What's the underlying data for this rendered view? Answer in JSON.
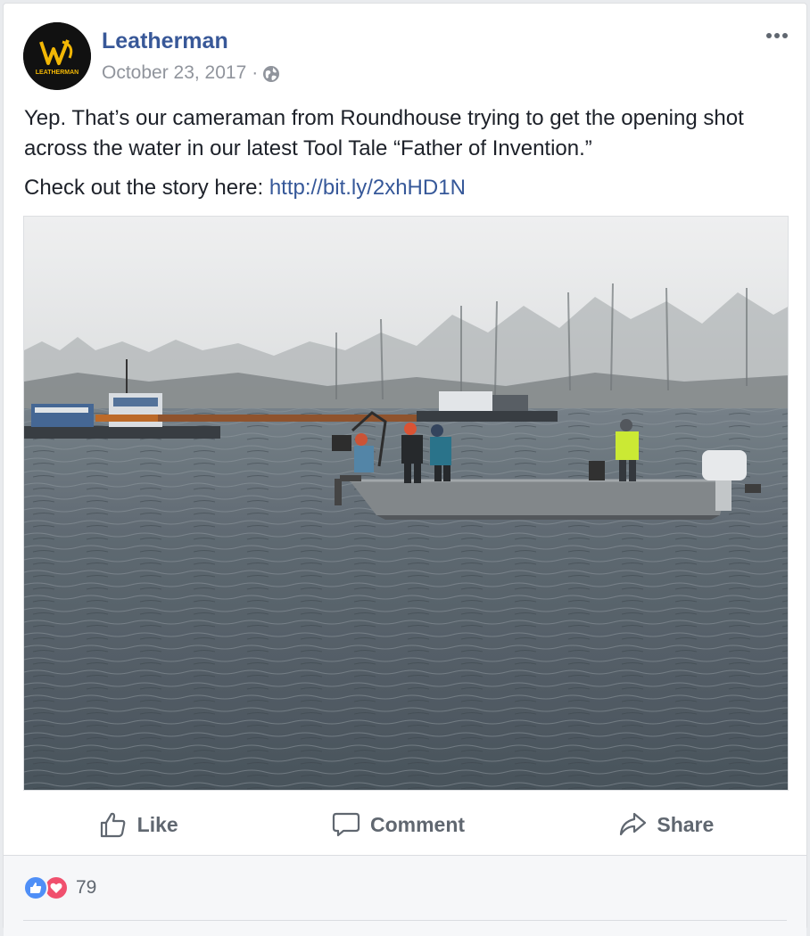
{
  "post": {
    "author": "Leatherman",
    "logo_text": "LEATHERMAN",
    "date": "October 23, 2017",
    "separator": "·",
    "privacy_icon": "globe-icon",
    "more_icon": "more-options-icon",
    "text_line_1": "Yep. That’s our cameraman from Roundhouse trying to get the opening shot across the water in our latest Tool Tale “Father of Invention.”",
    "text_prefix": "Check out the story here: ",
    "link": "http://bit.ly/2xhHD1N"
  },
  "actions": {
    "like_label": "Like",
    "comment_label": "Comment",
    "share_label": "Share"
  },
  "reactions": {
    "types": [
      "like-icon",
      "love-icon"
    ],
    "count": "79"
  },
  "colors": {
    "brand_link": "#385898",
    "meta": "#90949c",
    "action_text": "#606770",
    "like_blue": "#4f8ff7",
    "love_red": "#f0506e",
    "logo_yellow": "#f2b705"
  }
}
